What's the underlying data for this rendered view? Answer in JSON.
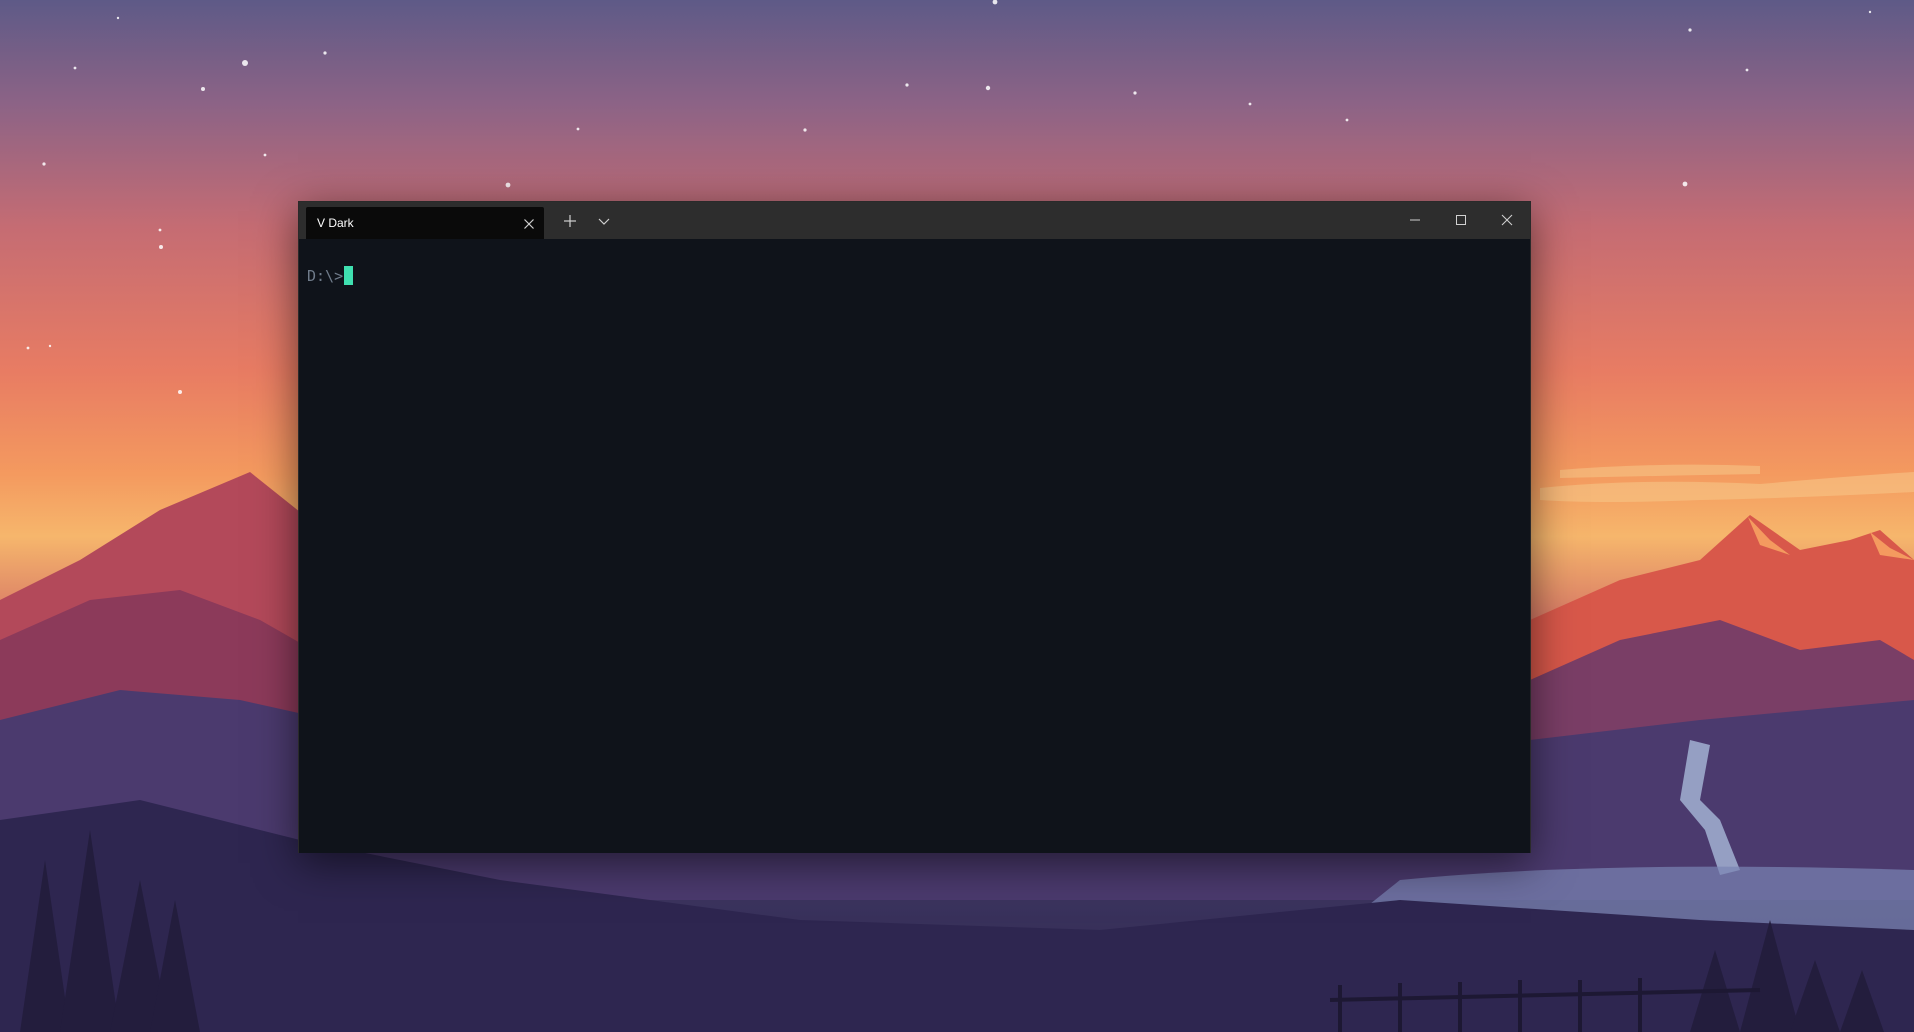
{
  "colors": {
    "titlebar_bg": "#2d2d2d",
    "active_tab_bg": "#0a0a0a",
    "terminal_bg": "#0f131a",
    "prompt_text": "#6f7b8a",
    "cursor": "#3fe0b0",
    "icon": "#d0d0d0"
  },
  "window": {
    "tab": {
      "title": "V Dark",
      "close_icon": "close-icon"
    },
    "new_tab_icon": "plus-icon",
    "dropdown_icon": "chevron-down-icon",
    "controls": {
      "minimize_icon": "minimize-icon",
      "maximize_icon": "maximize-icon",
      "close_icon": "close-icon"
    }
  },
  "terminal": {
    "prompt": "D:\\>"
  }
}
